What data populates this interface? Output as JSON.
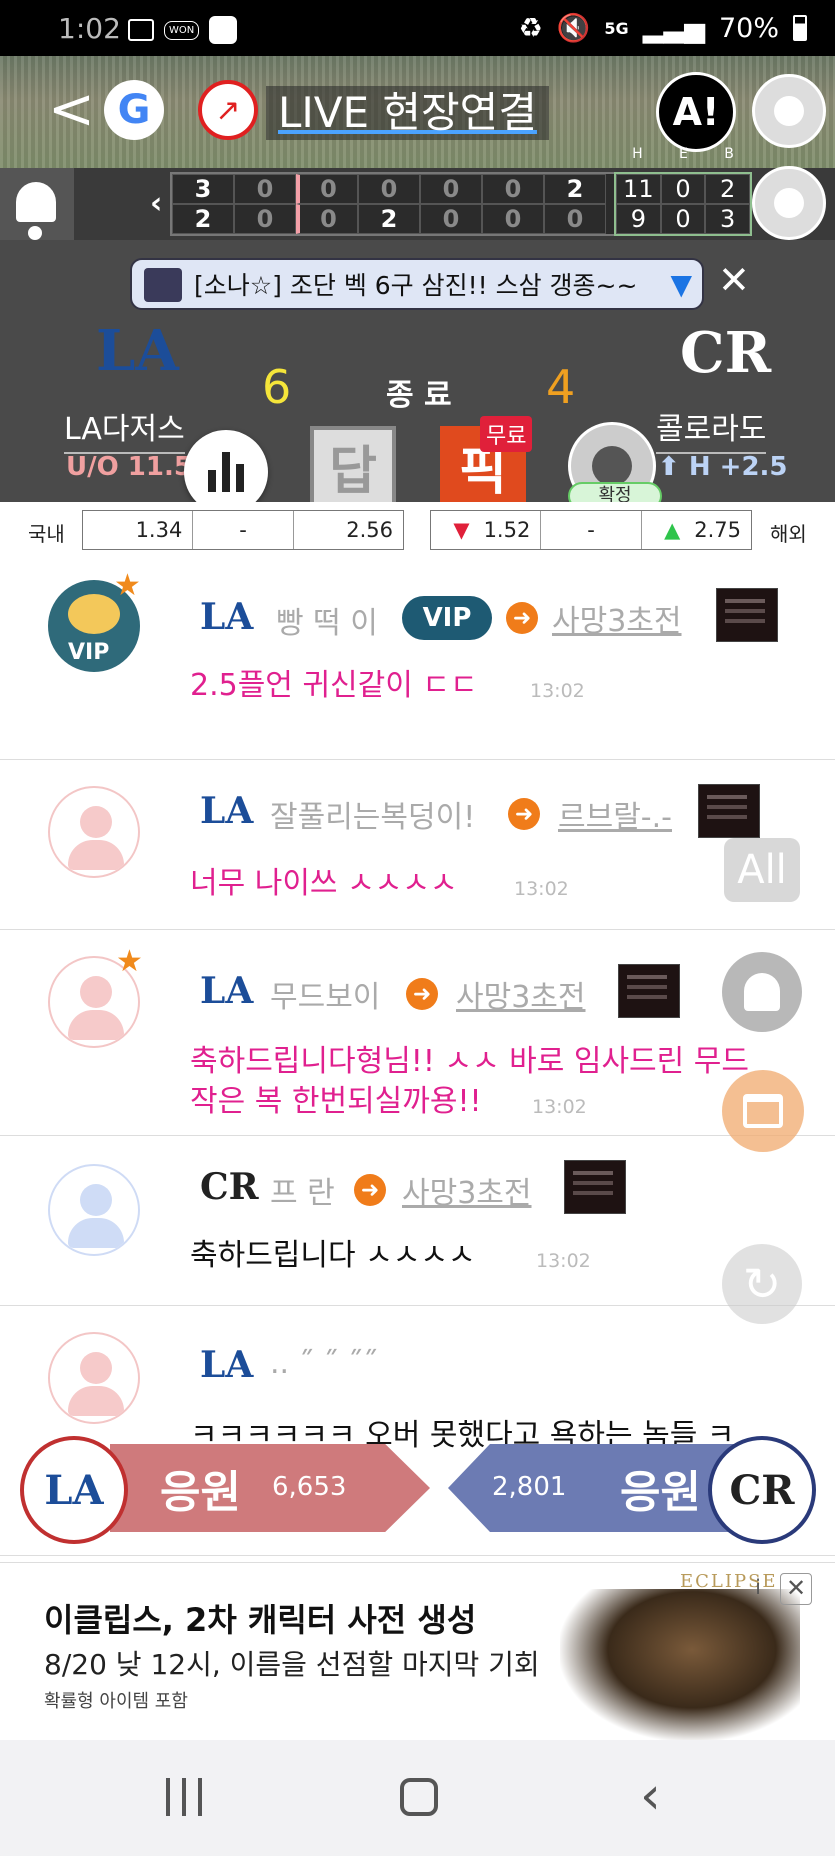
{
  "status_bar": {
    "time": "1:02",
    "won_label": "WON",
    "network": "5G",
    "battery": "70%"
  },
  "header": {
    "title": "LIVE 현장연결",
    "app_badge": "A!"
  },
  "scoreboard": {
    "heb_labels": [
      "H",
      "E",
      "B"
    ],
    "away_row": [
      "3",
      "0",
      "0",
      "0",
      "0",
      "0",
      "2",
      "0"
    ],
    "home_row": [
      "2",
      "0",
      "0",
      "2",
      "0",
      "0",
      "0",
      "0"
    ],
    "away_heb": [
      "11",
      "0",
      "2"
    ],
    "home_heb": [
      "9",
      "0",
      "3"
    ]
  },
  "notice": {
    "text": "[소나☆] 조단 벡 6구 삼진!! 스삼 갱종~~"
  },
  "game": {
    "home_team": "LA다저스",
    "away_team": "콜로라도",
    "home_score": "6",
    "away_score": "4",
    "status": "종 료",
    "home_line": "U/O 11.5",
    "away_line": "H +2.5",
    "answer_label": "답",
    "pick_label": "픽",
    "free_badge": "무료",
    "confirm_badge": "확정"
  },
  "odds": {
    "domestic_label": "국내",
    "overseas_label": "해외",
    "domestic": [
      "1.34",
      "-",
      "2.56"
    ],
    "overseas": [
      "1.52",
      "-",
      "2.75"
    ]
  },
  "messages": [
    {
      "nick": "빵 떡 이",
      "badge": "VIP",
      "title": "사망3초전",
      "text": "2.5플언 귀신같이 ㄷㄷ",
      "time": "13:02"
    },
    {
      "nick": "잘풀리는복덩이!",
      "title": "르브랄-.-",
      "text": "너무 나이쓰 ㅅㅅㅅㅅ",
      "time": "13:02"
    },
    {
      "nick": "무드보이",
      "title": "사망3초전",
      "text": "축하드립니다형님!! ㅅㅅ 바로 임사드린 무드",
      "text2": "작은 복 한번되실까용!!",
      "time": "13:02"
    },
    {
      "nick": "프 란",
      "title": "사망3초전",
      "text": "축하드립니다 ㅅㅅㅅㅅ",
      "time": "13:02"
    },
    {
      "nick": ".. ˝ ˝ ˝˝",
      "text": "ㅋㅋㅋㅋㅋㅋ 오버 못했다고 욕하는 놈들 ㅋ"
    }
  ],
  "floating": {
    "all_label": "All"
  },
  "cheer": {
    "home_label": "응원",
    "home_count": "6,653",
    "away_label": "응원",
    "away_count": "2,801"
  },
  "ad": {
    "title": "이클립스, 2차 캐릭터 사전 생성",
    "subtitle": "8/20 낮 12시, 이름을 선점할 마지막 기회",
    "note": "확률형 아이템 포함",
    "brand": "ECLIPSE"
  }
}
